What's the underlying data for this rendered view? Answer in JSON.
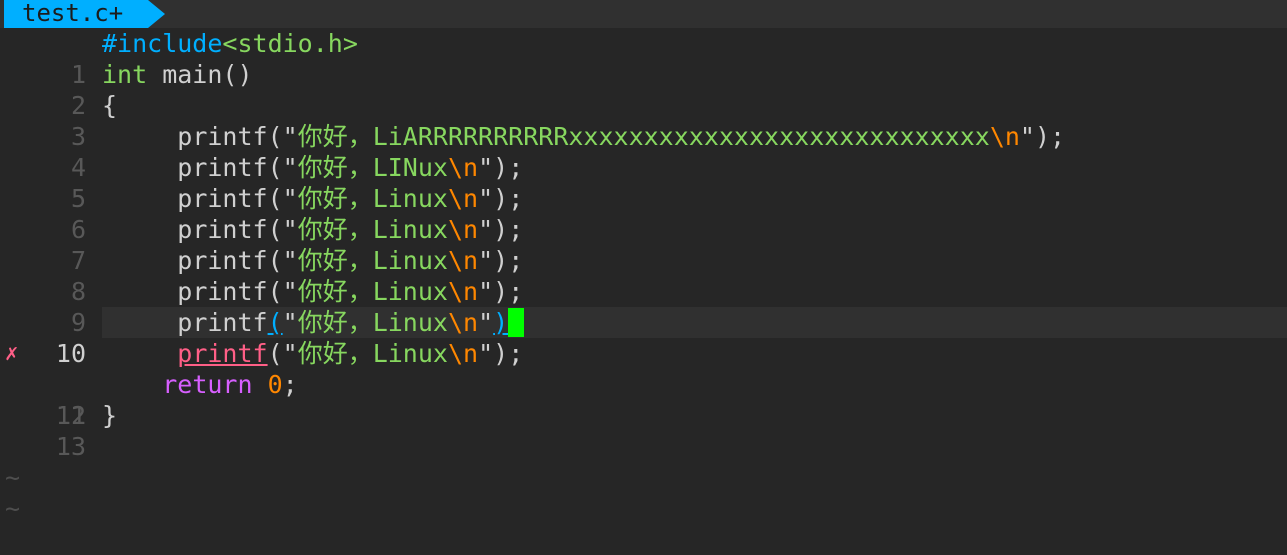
{
  "tab": {
    "filename": "test.c+"
  },
  "gutter": {
    "error_sign": "✗"
  },
  "lines": [
    {
      "n": "1",
      "pre": "#include",
      "inc": "<stdio.h>"
    },
    {
      "n": "2",
      "type": "int",
      "rest": " main()"
    },
    {
      "n": "3",
      "text": "{"
    },
    {
      "n": "4",
      "fn": "printf",
      "open": "(",
      "q1": "\"",
      "str": "你好，LiARRRRRRRRRRxxxxxxxxxxxxxxxxxxxxxxxxxxxx",
      "esc": "\\n",
      "q2": "\"",
      "close": ")",
      "tail": ";"
    },
    {
      "n": "5",
      "fn": "printf",
      "open": "(",
      "q1": "\"",
      "str": "你好，LINux",
      "esc": "\\n",
      "q2": "\"",
      "close": ")",
      "tail": ";"
    },
    {
      "n": "6",
      "fn": "printf",
      "open": "(",
      "q1": "\"",
      "str": "你好，Linux",
      "esc": "\\n",
      "q2": "\"",
      "close": ")",
      "tail": ";"
    },
    {
      "n": "7",
      "fn": "printf",
      "open": "(",
      "q1": "\"",
      "str": "你好，Linux",
      "esc": "\\n",
      "q2": "\"",
      "close": ")",
      "tail": ";"
    },
    {
      "n": "8",
      "fn": "printf",
      "open": "(",
      "q1": "\"",
      "str": "你好，Linux",
      "esc": "\\n",
      "q2": "\"",
      "close": ")",
      "tail": ";"
    },
    {
      "n": "9",
      "fn": "printf",
      "open": "(",
      "q1": "\"",
      "str": "你好，Linux",
      "esc": "\\n",
      "q2": "\"",
      "close": ")",
      "tail": ";"
    },
    {
      "n": "10",
      "fn": "printf",
      "open": "(",
      "q1": "\"",
      "str": "你好，Linux",
      "esc": "\\n",
      "q2": "\"",
      "close": ")"
    },
    {
      "n": "11",
      "fn": "printf",
      "open": "(",
      "q1": "\"",
      "str": "你好，Linux",
      "esc": "\\n",
      "q2": "\"",
      "close": ")",
      "tail": ";"
    },
    {
      "n": "12",
      "ret": "return",
      "num": "0",
      "tail": ";"
    },
    {
      "n": "13",
      "text": "}"
    }
  ],
  "empty_marker": "~",
  "colors": {
    "tab_bg": "#00afff",
    "cursor": "#00ff00",
    "error": "#ff5f87",
    "string": "#87d75f",
    "escape": "#ff8700",
    "keyword": "#d75fff"
  }
}
